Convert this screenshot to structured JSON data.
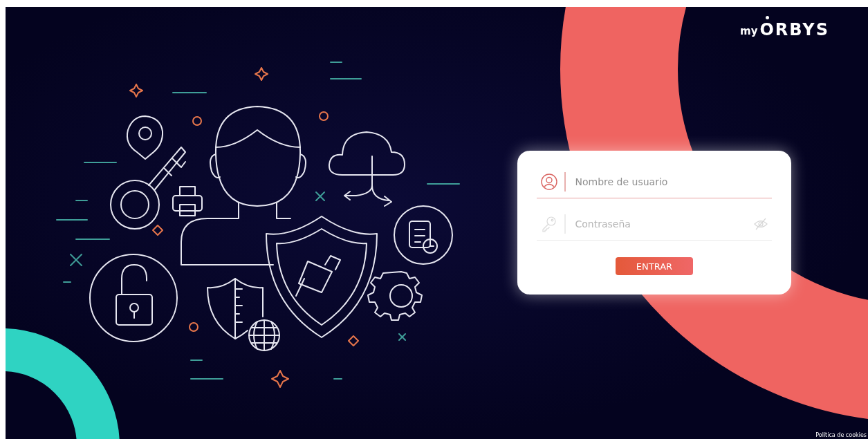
{
  "logo": {
    "prefix": "my",
    "name": "ORBYS"
  },
  "login_form": {
    "username": {
      "placeholder": "Nombre de usuario",
      "focused": true
    },
    "password": {
      "placeholder": "Contraseña",
      "focused": false
    },
    "submit_button": "ENTRAR"
  },
  "footer_link": "Política de cookies"
}
